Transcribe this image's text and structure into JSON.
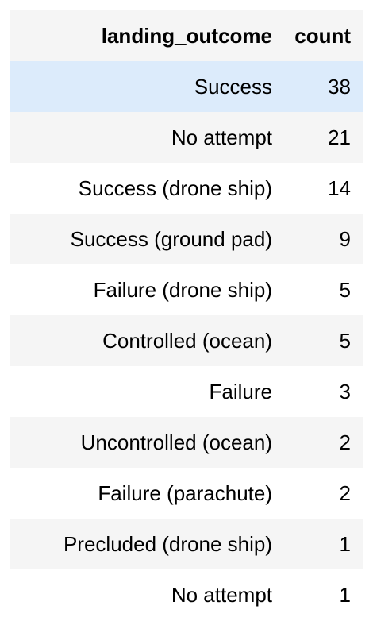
{
  "table": {
    "columns": [
      "landing_outcome",
      "count"
    ],
    "rows": [
      {
        "landing_outcome": "Success",
        "count": "38"
      },
      {
        "landing_outcome": "No attempt",
        "count": "21"
      },
      {
        "landing_outcome": "Success (drone ship)",
        "count": "14"
      },
      {
        "landing_outcome": "Success (ground pad)",
        "count": "9"
      },
      {
        "landing_outcome": "Failure (drone ship)",
        "count": "5"
      },
      {
        "landing_outcome": "Controlled (ocean)",
        "count": "5"
      },
      {
        "landing_outcome": "Failure",
        "count": "3"
      },
      {
        "landing_outcome": "Uncontrolled (ocean)",
        "count": "2"
      },
      {
        "landing_outcome": "Failure (parachute)",
        "count": "2"
      },
      {
        "landing_outcome": "Precluded (drone ship)",
        "count": "1"
      },
      {
        "landing_outcome": "No attempt",
        "count": "1"
      }
    ],
    "highlight_color": "#dcebfb",
    "stripe_color": "#f5f5f5"
  }
}
